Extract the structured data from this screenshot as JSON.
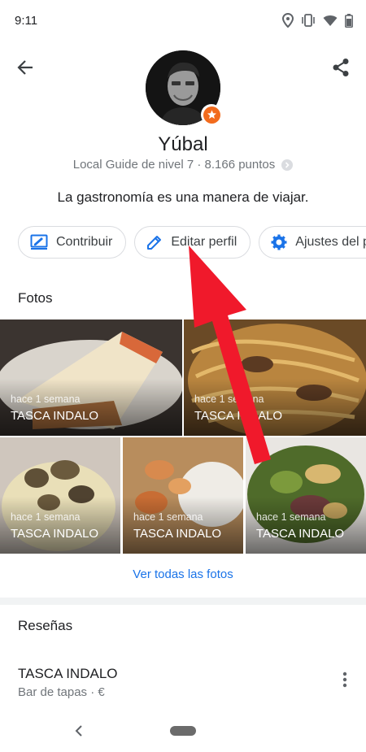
{
  "status_bar": {
    "time": "9:11",
    "icons": [
      "location-icon",
      "vibrate-icon",
      "wifi-icon",
      "battery-icon"
    ]
  },
  "top_bar": {
    "back_icon": "arrow-back-icon",
    "share_icon": "share-icon"
  },
  "profile": {
    "name": "Yúbal",
    "level": "Local Guide de nivel 7 · 8.166 puntos",
    "bio": "La gastronomía es una manera de viajar.",
    "badge_color": "#f26b1d"
  },
  "actions": [
    {
      "label": "Contribuir",
      "icon": "contribute-icon"
    },
    {
      "label": "Editar perfil",
      "icon": "edit-icon"
    },
    {
      "label": "Ajustes del p",
      "icon": "settings-icon"
    }
  ],
  "photos": {
    "title": "Fotos",
    "items": [
      {
        "time": "hace 1 semana",
        "place": "TASCA INDALO"
      },
      {
        "time": "hace 1 semana",
        "place": "TASCA INDALO"
      },
      {
        "time": "hace 1 semana",
        "place": "TASCA INDALO"
      },
      {
        "time": "hace 1 semana",
        "place": "TASCA INDALO"
      },
      {
        "time": "hace 1 semana",
        "place": "TASCA INDALO"
      }
    ],
    "see_all": "Ver todas las fotos"
  },
  "reviews": {
    "title": "Reseñas",
    "place": "TASCA INDALO",
    "subtitle": "Bar de tapas · €"
  },
  "colors": {
    "accent": "#1a73e8",
    "annotation_arrow": "#f0192b"
  }
}
